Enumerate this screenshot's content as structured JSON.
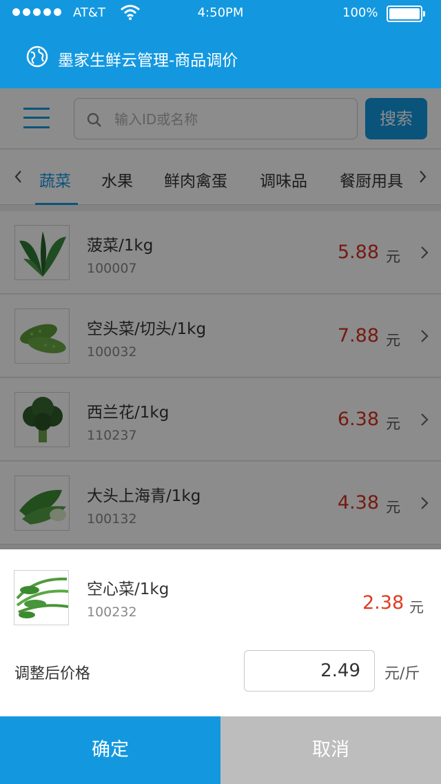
{
  "status_bar": {
    "carrier": "AT&T",
    "time": "4:50PM",
    "battery": "100%"
  },
  "header": {
    "title": "墨家生鲜云管理-商品调价"
  },
  "search": {
    "placeholder": "输入ID或名称",
    "button_label": "搜索"
  },
  "tabs": [
    {
      "label": "蔬菜",
      "active": true
    },
    {
      "label": "水果",
      "active": false
    },
    {
      "label": "鲜肉禽蛋",
      "active": false
    },
    {
      "label": "调味品",
      "active": false
    },
    {
      "label": "餐厨用具",
      "active": false
    }
  ],
  "products": [
    {
      "name": "菠菜/1kg",
      "id": "100007",
      "price": "5.88",
      "unit": "元",
      "image": "spinach"
    },
    {
      "name": "空头菜/切头/1kg",
      "id": "100032",
      "price": "7.88",
      "unit": "元",
      "image": "bitter-melon"
    },
    {
      "name": "西兰花/1kg",
      "id": "110237",
      "price": "6.38",
      "unit": "元",
      "image": "broccoli"
    },
    {
      "name": "大头上海青/1kg",
      "id": "100132",
      "price": "4.38",
      "unit": "元",
      "image": "bok-choy"
    }
  ],
  "sheet": {
    "name": "空心菜/1kg",
    "id": "100232",
    "price": "2.38",
    "unit": "元",
    "image": "water-spinach",
    "adjust_label": "调整后价格",
    "adjust_value": "2.49",
    "adjust_unit": "元/斤",
    "confirm_label": "确定",
    "cancel_label": "取消"
  },
  "colors": {
    "primary": "#1398e0",
    "price": "#d5311f",
    "cancel": "#bdbdbd"
  }
}
